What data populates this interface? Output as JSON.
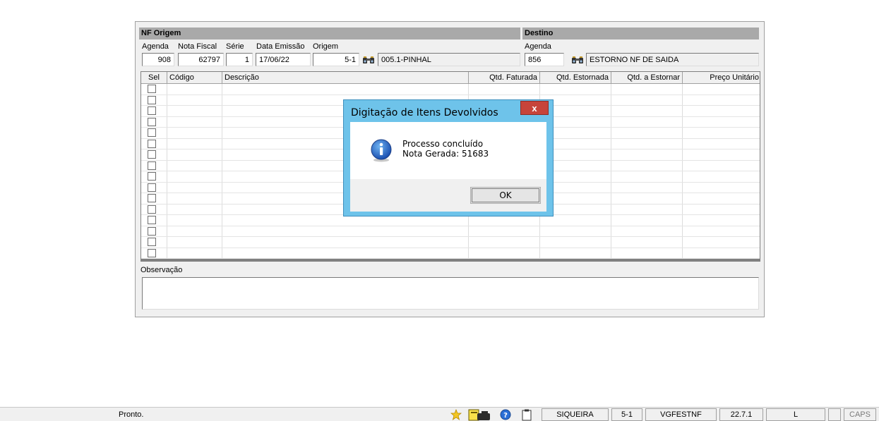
{
  "form": {
    "origem_header": "NF Origem",
    "destino_header": "Destino",
    "labels": {
      "agenda": "Agenda",
      "nota_fiscal": "Nota Fiscal",
      "serie": "Série",
      "data_emissao": "Data Emissão",
      "origem": "Origem",
      "destino_agenda": "Agenda"
    },
    "values": {
      "agenda": "908",
      "nota_fiscal": "62797",
      "serie": "1",
      "data_emissao": "17/06/22",
      "origem": "5-1",
      "origem_desc": "005.1-PINHAL",
      "destino_agenda": "856",
      "destino_desc": "ESTORNO NF DE SAIDA"
    }
  },
  "grid": {
    "columns": [
      "Sel",
      "Código",
      "Descrição",
      "Qtd. Faturada",
      "Qtd. Estornada",
      "Qtd. a Estornar",
      "Preço Unitário"
    ],
    "row_count": 16
  },
  "observacao_label": "Observação",
  "dialog": {
    "title": "Digitação de Itens Devolvidos",
    "close_label": "x",
    "line1": "Processo concluído",
    "line2": "Nota Gerada: 51683",
    "ok_label": "OK",
    "icon": "info-icon"
  },
  "statusbar": {
    "ready": "Pronto.",
    "user": "SIQUEIRA",
    "branch": "5-1",
    "module": "VGFESTNF",
    "version": "22.7.1",
    "mode": "L",
    "caps": "CAPS"
  },
  "colors": {
    "dialog_frame": "#6ec3ea",
    "close_button": "#c7443a",
    "header_bar": "#a9a9a9"
  }
}
